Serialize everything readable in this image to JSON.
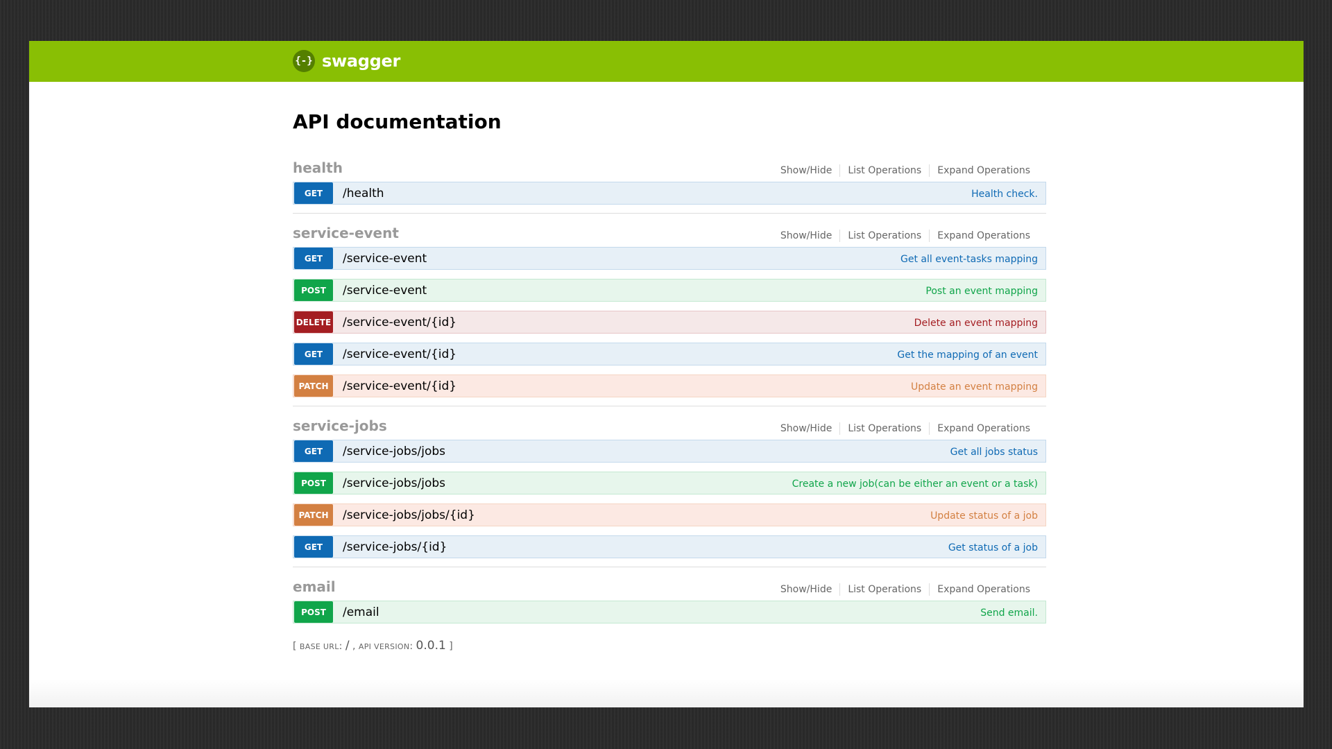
{
  "header": {
    "logo_icon": "{-}",
    "logo_text": "swagger",
    "brand_color": "#89bf04"
  },
  "page": {
    "title": "API documentation"
  },
  "links": {
    "show_hide": "Show/Hide",
    "list_operations": "List Operations",
    "expand_operations": "Expand Operations"
  },
  "resources": [
    {
      "name": "health",
      "operations": [
        {
          "method": "GET",
          "path": "/health",
          "summary": "Health check."
        }
      ]
    },
    {
      "name": "service-event",
      "operations": [
        {
          "method": "GET",
          "path": "/service-event",
          "summary": "Get all event-tasks mapping"
        },
        {
          "method": "POST",
          "path": "/service-event",
          "summary": "Post an event mapping"
        },
        {
          "method": "DELETE",
          "path": "/service-event/{id}",
          "summary": "Delete an event mapping"
        },
        {
          "method": "GET",
          "path": "/service-event/{id}",
          "summary": "Get the mapping of an event"
        },
        {
          "method": "PATCH",
          "path": "/service-event/{id}",
          "summary": "Update an event mapping"
        }
      ]
    },
    {
      "name": "service-jobs",
      "operations": [
        {
          "method": "GET",
          "path": "/service-jobs/jobs",
          "summary": "Get all jobs status"
        },
        {
          "method": "POST",
          "path": "/service-jobs/jobs",
          "summary": "Create a new job(can be either an event or a task)"
        },
        {
          "method": "PATCH",
          "path": "/service-jobs/jobs/{id}",
          "summary": "Update status of a job"
        },
        {
          "method": "GET",
          "path": "/service-jobs/{id}",
          "summary": "Get status of a job"
        }
      ]
    },
    {
      "name": "email",
      "operations": [
        {
          "method": "POST",
          "path": "/email",
          "summary": "Send email."
        }
      ]
    }
  ],
  "footer": {
    "open_bracket": "[",
    "base_url_label": "Base URL",
    "base_url_value": "/",
    "separator": ",",
    "api_version_label": "API version",
    "api_version_value": "0.0.1",
    "close_bracket": "]"
  },
  "method_colors": {
    "GET": "#0f6ab4",
    "POST": "#10a54a",
    "DELETE": "#a41e22",
    "PATCH": "#d38042"
  }
}
